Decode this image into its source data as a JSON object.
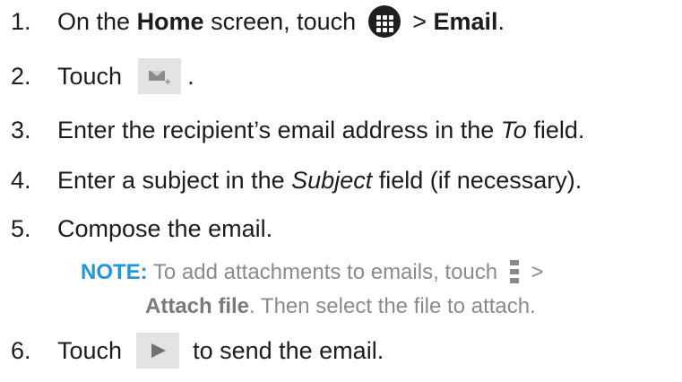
{
  "steps": [
    {
      "num": "1.",
      "text_a": "On the ",
      "bold_a": "Home",
      "text_b": " screen, touch ",
      "text_c": " > ",
      "bold_b": "Email",
      "text_d": "."
    },
    {
      "num": "2.",
      "text_a": "Touch ",
      "text_b": " ."
    },
    {
      "num": "3.",
      "text_a": "Enter the recipient’s email address in the ",
      "italic": "To",
      "text_b": " field."
    },
    {
      "num": "4.",
      "text_a": "Enter a subject in the ",
      "italic": "Subject",
      "text_b": " field (if necessary)."
    },
    {
      "num": "5.",
      "text_a": "Compose the email."
    },
    {
      "num": "6.",
      "text_a": "Touch ",
      "text_b": " to send the email."
    }
  ],
  "note": {
    "label": "NOTE:",
    "text_a": " To add attachments to emails, touch ",
    "text_b": " >",
    "bold": "Attach file",
    "text_c": ". Then select the file to attach."
  },
  "icons": {
    "apps": "apps-launcher-icon",
    "compose": "compose-email-icon",
    "menu": "overflow-menu-icon",
    "send": "send-icon"
  },
  "colors": {
    "note_label": "#2196d8",
    "note_text": "#8a8a8a",
    "icon_bg": "#e3e3e3"
  }
}
